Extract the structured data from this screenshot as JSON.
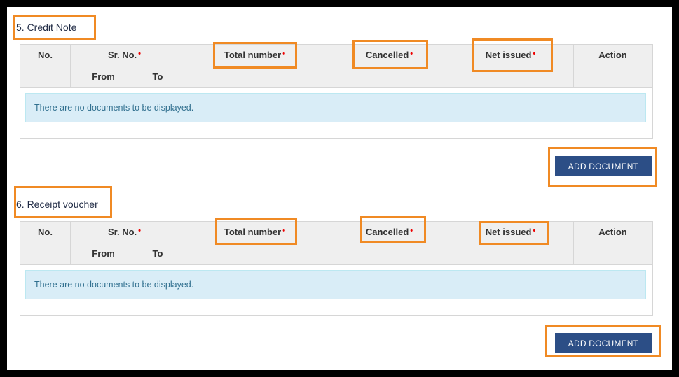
{
  "sections": [
    {
      "title": "5. Credit Note",
      "columns": {
        "no": "No.",
        "sr_no": "Sr. No.",
        "from": "From",
        "to": "To",
        "total_number": "Total number",
        "cancelled": "Cancelled",
        "net_issued": "Net issued",
        "action": "Action"
      },
      "required_marker": "•",
      "empty_message": "There are no documents to be displayed.",
      "add_button": "ADD DOCUMENT"
    },
    {
      "title": "6. Receipt voucher",
      "columns": {
        "no": "No.",
        "sr_no": "Sr. No.",
        "from": "From",
        "to": "To",
        "total_number": "Total number",
        "cancelled": "Cancelled",
        "net_issued": "Net issued",
        "action": "Action"
      },
      "required_marker": "•",
      "empty_message": "There are no documents to be displayed.",
      "add_button": "ADD DOCUMENT"
    }
  ],
  "colors": {
    "highlight": "#f08a24",
    "button_bg": "#2c4e86",
    "info_bg": "#d9edf7",
    "required": "#e00000"
  }
}
